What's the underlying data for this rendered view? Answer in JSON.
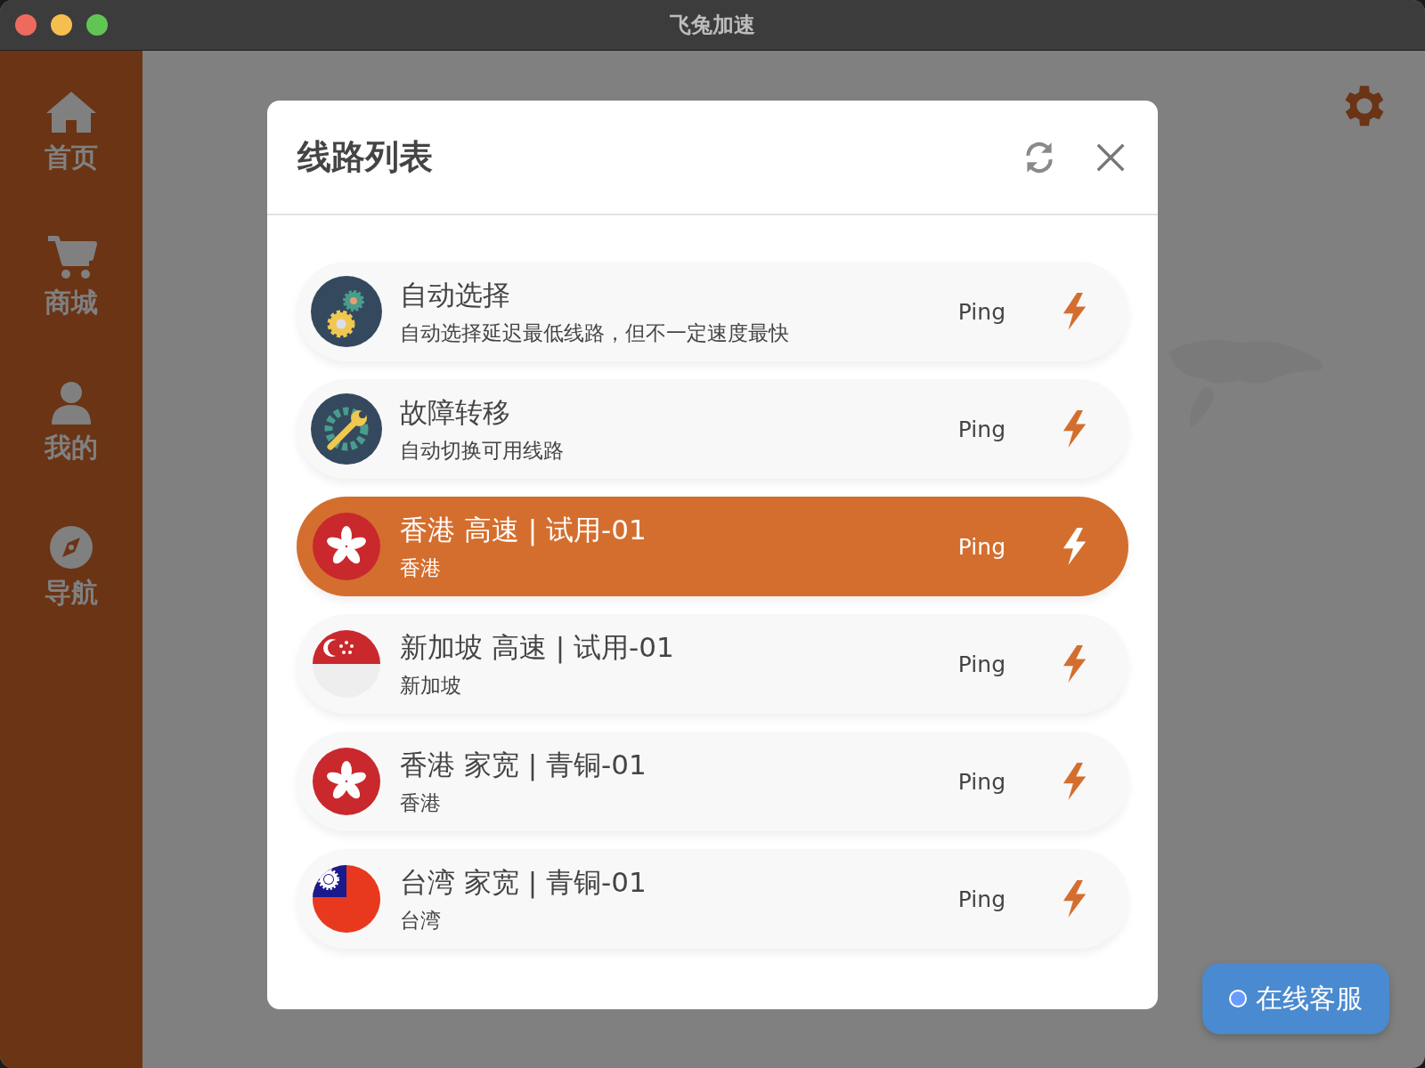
{
  "window": {
    "title": "飞兔加速"
  },
  "sidebar": {
    "items": [
      {
        "kind": "home",
        "label": "首页"
      },
      {
        "kind": "cart",
        "label": "商城"
      },
      {
        "kind": "user",
        "label": "我的"
      },
      {
        "kind": "compass",
        "label": "导航"
      }
    ]
  },
  "dialog": {
    "title": "线路列表",
    "routes": [
      {
        "kind": "gears",
        "title": "自动选择",
        "subtitle": "自动选择延迟最低线路，但不一定速度最快",
        "ping": "Ping",
        "selected": false
      },
      {
        "kind": "wrench",
        "title": "故障转移",
        "subtitle": "自动切换可用线路",
        "ping": "Ping",
        "selected": false
      },
      {
        "kind": "flag-hk",
        "title": "香港 高速 | 试用-01",
        "subtitle": "香港",
        "ping": "Ping",
        "selected": true
      },
      {
        "kind": "flag-sg",
        "title": "新加坡 高速 | 试用-01",
        "subtitle": "新加坡",
        "ping": "Ping",
        "selected": false
      },
      {
        "kind": "flag-hk",
        "title": "香港 家宽 | 青铜-01",
        "subtitle": "香港",
        "ping": "Ping",
        "selected": false
      },
      {
        "kind": "flag-tw",
        "title": "台湾 家宽 | 青铜-01",
        "subtitle": "台湾",
        "ping": "Ping",
        "selected": false
      }
    ]
  },
  "support_button": {
    "label": "在线客服"
  }
}
